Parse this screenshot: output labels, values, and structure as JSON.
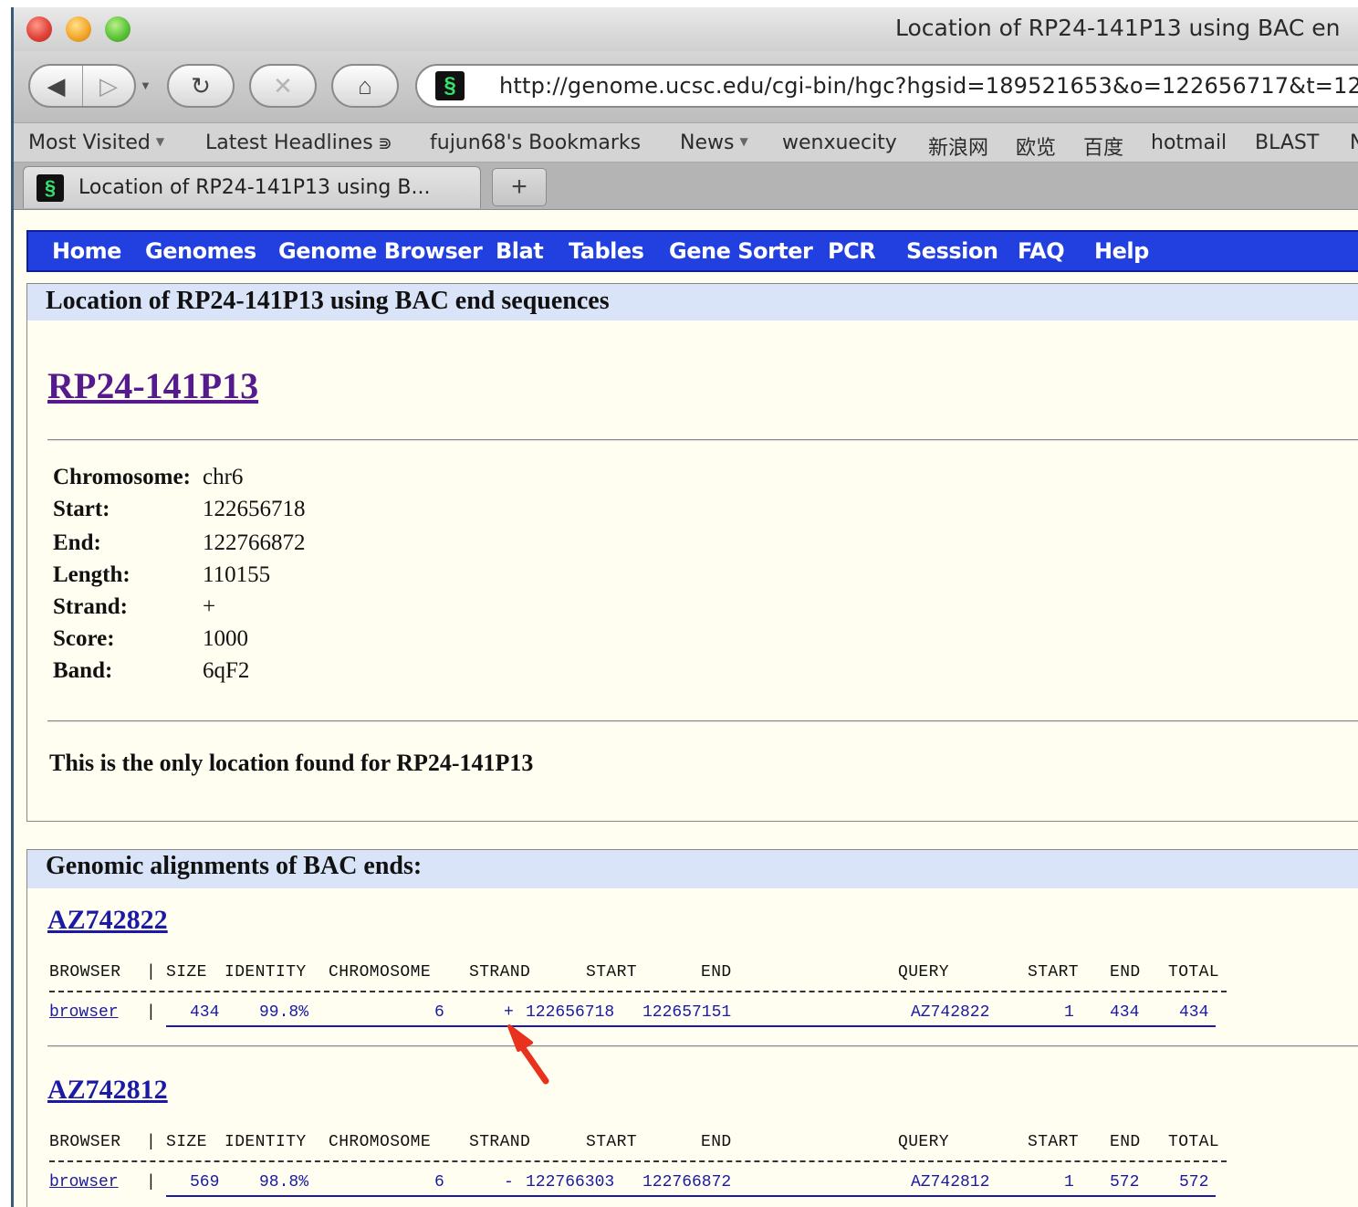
{
  "window": {
    "title": "Location of RP24-141P13 using BAC en",
    "url": "http://genome.ucsc.edu/cgi-bin/hgc?hgsid=189521653&o=122656717&t=12"
  },
  "bookmarks": [
    {
      "label": "Most Visited",
      "dropdown": true
    },
    {
      "label": "Latest Headlines",
      "rss": true
    },
    {
      "label": "fujun68's Bookmarks"
    },
    {
      "label": "News",
      "dropdown": true
    },
    {
      "label": "wenxuecity"
    },
    {
      "label": "新浪网"
    },
    {
      "label": "欧览"
    },
    {
      "label": "百度"
    },
    {
      "label": "hotmail"
    },
    {
      "label": "BLAST"
    },
    {
      "label": "N"
    }
  ],
  "tab": {
    "title": "Location of RP24-141P13 using B...",
    "new_tab": "+"
  },
  "nav": [
    "Home",
    "Genomes",
    "Genome Browser",
    "Blat",
    "Tables",
    "Gene Sorter",
    "PCR",
    "Session",
    "FAQ",
    "Help"
  ],
  "section1": {
    "heading": "Location of RP24-141P13 using BAC end sequences",
    "clone": "RP24-141P13",
    "fields": [
      {
        "label": "Chromosome:",
        "value": "chr6"
      },
      {
        "label": "Start:",
        "value": "122656718"
      },
      {
        "label": "End:",
        "value": "122766872"
      },
      {
        "label": "Length:",
        "value": "110155"
      },
      {
        "label": "Strand:",
        "value": "+"
      },
      {
        "label": "Score:",
        "value": "1000"
      },
      {
        "label": "Band:",
        "value": "6qF2"
      }
    ],
    "note": "This is the only location found for RP24-141P13"
  },
  "section2": {
    "heading": "Genomic alignments of BAC ends:",
    "columns": [
      "BROWSER",
      "|",
      "SIZE",
      "IDENTITY",
      "CHROMOSOME",
      "STRAND",
      "START",
      "END",
      "QUERY",
      "START",
      "END",
      "TOTAL"
    ],
    "alignments": [
      {
        "accession": "AZ742822",
        "browser": "browser",
        "sep": "|",
        "size": "434",
        "identity": "99.8%",
        "chromosome": "6",
        "strand": "+",
        "start": "122656718",
        "end": "122657151",
        "query": "AZ742822",
        "qstart": "1",
        "qend": "434",
        "total": "434"
      },
      {
        "accession": "AZ742812",
        "browser": "browser",
        "sep": "|",
        "size": "569",
        "identity": "98.8%",
        "chromosome": "6",
        "strand": "-",
        "start": "122766303",
        "end": "122766872",
        "query": "AZ742812",
        "qstart": "1",
        "qend": "572",
        "total": "572"
      }
    ]
  },
  "annotation": {
    "arrow_color": "#e8321e"
  }
}
